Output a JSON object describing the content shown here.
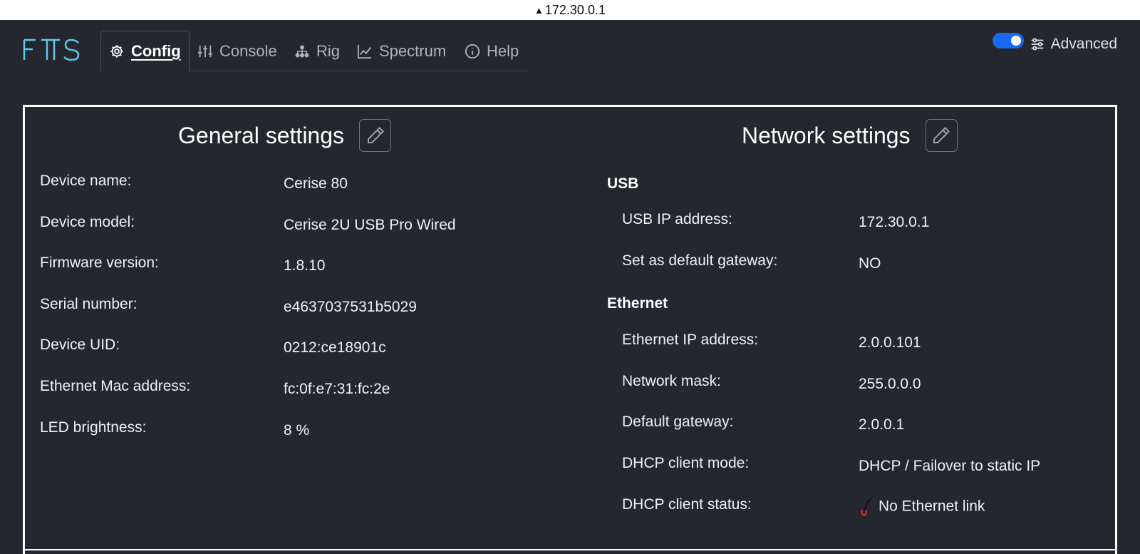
{
  "browser": {
    "address": "172.30.0.1"
  },
  "nav": {
    "tabs": [
      {
        "label": "Config",
        "icon": "gear-icon",
        "active": true
      },
      {
        "label": "Console",
        "icon": "sliders-icon"
      },
      {
        "label": "Rig",
        "icon": "hierarchy-icon"
      },
      {
        "label": "Spectrum",
        "icon": "line-chart-icon"
      },
      {
        "label": "Help",
        "icon": "info-icon"
      }
    ]
  },
  "advanced": {
    "label": "Advanced",
    "enabled": true
  },
  "general": {
    "title": "General settings",
    "rows": [
      {
        "label": "Device name:",
        "value": "Cerise 80"
      },
      {
        "label": "Device model:",
        "value": "Cerise 2U USB Pro Wired"
      },
      {
        "label": "Firmware version:",
        "value": "1.8.10"
      },
      {
        "label": "Serial number:",
        "value": "e4637037531b5029"
      },
      {
        "label": "Device UID:",
        "value": "0212:ce18901c"
      },
      {
        "label": "Ethernet Mac address:",
        "value": "fc:0f:e7:31:fc:2e"
      },
      {
        "label": "LED brightness:",
        "value": "8 %"
      }
    ]
  },
  "network": {
    "title": "Network settings",
    "usb": {
      "title": "USB",
      "rows": [
        {
          "label": "USB IP address:",
          "value": "172.30.0.1"
        },
        {
          "label": "Set as default gateway:",
          "value": "NO"
        }
      ]
    },
    "ethernet": {
      "title": "Ethernet",
      "rows": [
        {
          "label": "Ethernet IP address:",
          "value": "2.0.0.101"
        },
        {
          "label": "Network mask:",
          "value": "255.0.0.0"
        },
        {
          "label": "Default gateway:",
          "value": "2.0.0.1"
        },
        {
          "label": "DHCP client mode:",
          "value": "DHCP / Failover to static IP"
        },
        {
          "label": "DHCP client status:",
          "value": "No Ethernet link",
          "icon": "unplugged-icon",
          "status_color": "#e0302b"
        }
      ]
    }
  },
  "colors": {
    "accent": "#1668f5",
    "logo": "#5cc8f0",
    "background": "#24272d"
  }
}
